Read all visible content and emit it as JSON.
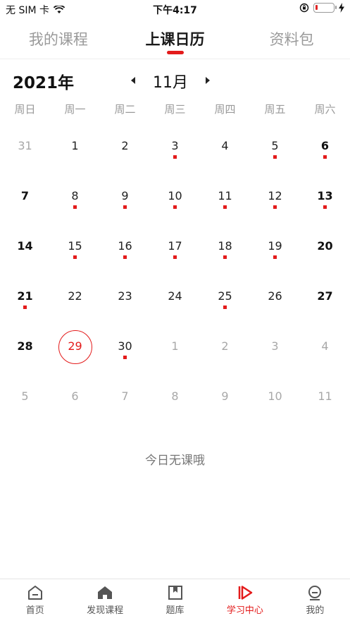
{
  "status_bar": {
    "carrier": "无 SIM 卡",
    "time": "下午4:17",
    "battery_level": 0.15
  },
  "top_tabs": [
    {
      "label": "我的课程",
      "active": false
    },
    {
      "label": "上课日历",
      "active": true
    },
    {
      "label": "资料包",
      "active": false
    }
  ],
  "calendar": {
    "year": "2021年",
    "month": "11月",
    "weekdays": [
      "周日",
      "周一",
      "周二",
      "周三",
      "周四",
      "周五",
      "周六"
    ],
    "weeks": [
      [
        {
          "d": "31",
          "o": true
        },
        {
          "d": "1"
        },
        {
          "d": "2"
        },
        {
          "d": "3",
          "c": true
        },
        {
          "d": "4"
        },
        {
          "d": "5",
          "c": true
        },
        {
          "d": "6",
          "c": true
        }
      ],
      [
        {
          "d": "7"
        },
        {
          "d": "8",
          "c": true
        },
        {
          "d": "9",
          "c": true
        },
        {
          "d": "10",
          "c": true
        },
        {
          "d": "11",
          "c": true
        },
        {
          "d": "12",
          "c": true
        },
        {
          "d": "13",
          "c": true
        }
      ],
      [
        {
          "d": "14"
        },
        {
          "d": "15",
          "c": true
        },
        {
          "d": "16",
          "c": true
        },
        {
          "d": "17",
          "c": true
        },
        {
          "d": "18",
          "c": true
        },
        {
          "d": "19",
          "c": true
        },
        {
          "d": "20"
        }
      ],
      [
        {
          "d": "21",
          "c": true
        },
        {
          "d": "22"
        },
        {
          "d": "23"
        },
        {
          "d": "24"
        },
        {
          "d": "25",
          "c": true
        },
        {
          "d": "26"
        },
        {
          "d": "27"
        }
      ],
      [
        {
          "d": "28"
        },
        {
          "d": "29",
          "t": true
        },
        {
          "d": "30",
          "c": true
        },
        {
          "d": "1",
          "o": true
        },
        {
          "d": "2",
          "o": true
        },
        {
          "d": "3",
          "o": true
        },
        {
          "d": "4",
          "o": true
        }
      ],
      [
        {
          "d": "5",
          "o": true
        },
        {
          "d": "6",
          "o": true
        },
        {
          "d": "7",
          "o": true
        },
        {
          "d": "8",
          "o": true
        },
        {
          "d": "9",
          "o": true
        },
        {
          "d": "10",
          "o": true
        },
        {
          "d": "11",
          "o": true
        }
      ]
    ],
    "empty_message": "今日无课哦"
  },
  "bottom_nav": [
    {
      "label": "首页",
      "icon": "home-icon",
      "active": false
    },
    {
      "label": "发现课程",
      "icon": "discover-icon",
      "active": false
    },
    {
      "label": "题库",
      "icon": "question-bank-icon",
      "active": false
    },
    {
      "label": "学习中心",
      "icon": "study-center-icon",
      "active": true
    },
    {
      "label": "我的",
      "icon": "profile-icon",
      "active": false
    }
  ],
  "colors": {
    "accent": "#e31b1b",
    "muted": "#9a9a9a"
  }
}
